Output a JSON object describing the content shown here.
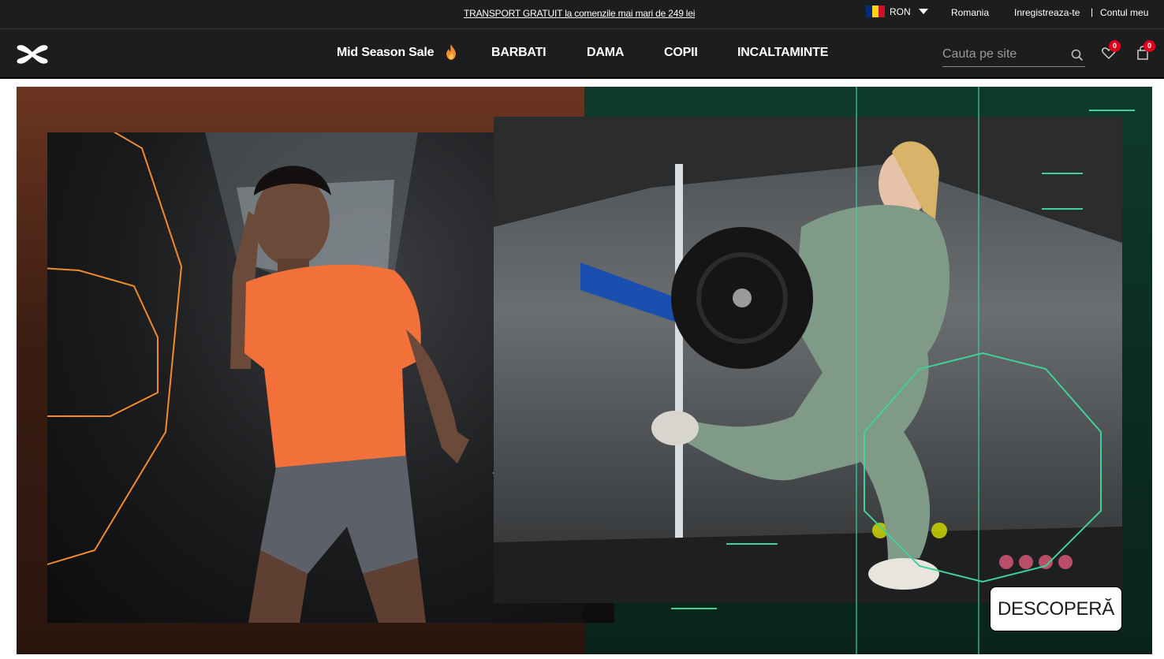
{
  "topbar": {
    "promo_text": "TRANSPORT GRATUIT la comenzile mai mari de 249 lei",
    "currency": "RON",
    "country": "Romania",
    "register": "Inregistreaza-te",
    "separator": "|",
    "account": "Contul meu"
  },
  "nav": {
    "items": [
      {
        "label": "Mid Season Sale",
        "icon": "flame-icon"
      },
      {
        "label": "BARBATI"
      },
      {
        "label": "DAMA"
      },
      {
        "label": "COPII"
      },
      {
        "label": "INCALTAMINTE"
      }
    ],
    "search_placeholder": "Cauta pe site",
    "wishlist_count": "0",
    "cart_count": "0"
  },
  "hero": {
    "cta_label": "DESCOPERĂ"
  },
  "colors": {
    "header_bg": "#1d1d1d",
    "badge": "#e3001b",
    "accent_orange": "#f28a2e",
    "accent_green": "#3fd19a"
  }
}
